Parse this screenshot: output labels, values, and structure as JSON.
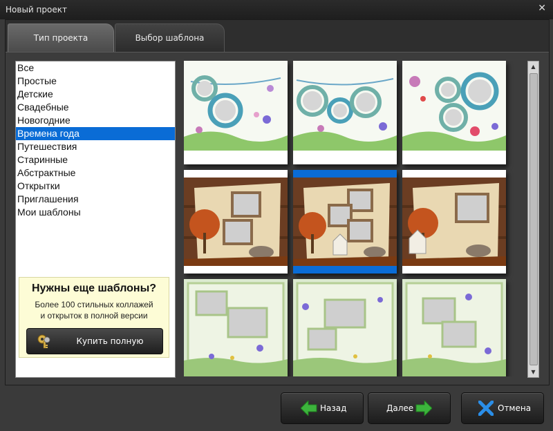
{
  "window": {
    "title": "Новый проект",
    "close_glyph": "✕"
  },
  "tabs": [
    {
      "label": "Тип проекта",
      "active": true
    },
    {
      "label": "Выбор шаблона",
      "active": false
    }
  ],
  "categories": [
    {
      "label": "Все",
      "selected": false
    },
    {
      "label": "Простые",
      "selected": false
    },
    {
      "label": "Детские",
      "selected": false
    },
    {
      "label": "Свадебные",
      "selected": false
    },
    {
      "label": "Новогодние",
      "selected": false
    },
    {
      "label": "Времена года",
      "selected": true
    },
    {
      "label": "Путешествия",
      "selected": false
    },
    {
      "label": "Старинные",
      "selected": false
    },
    {
      "label": "Абстрактные",
      "selected": false
    },
    {
      "label": "Открытки",
      "selected": false
    },
    {
      "label": "Приглашения",
      "selected": false
    },
    {
      "label": "Мои шаблоны",
      "selected": false
    }
  ],
  "promo": {
    "title": "Нужны еще шаблоны?",
    "line1": "Более 100 стильных коллажей",
    "line2": "и открыток в полной версии",
    "buy_label": "Купить полную версию!",
    "buy_icon": "keys-icon"
  },
  "templates": [
    {
      "theme": "spring-garlands",
      "selected": false
    },
    {
      "theme": "spring-garlands",
      "selected": false
    },
    {
      "theme": "spring-garlands",
      "selected": false
    },
    {
      "theme": "autumn-wood",
      "selected": false
    },
    {
      "theme": "autumn-wood",
      "selected": true
    },
    {
      "theme": "autumn-wood",
      "selected": false
    },
    {
      "theme": "spring-flowers-frame",
      "selected": false
    },
    {
      "theme": "spring-flowers-frame",
      "selected": false
    },
    {
      "theme": "spring-flowers-frame",
      "selected": false
    }
  ],
  "scrollbar": {
    "up_glyph": "▲",
    "down_glyph": "▼"
  },
  "buttons": {
    "back": {
      "label": "Назад",
      "icon": "arrow-left-icon"
    },
    "next": {
      "label": "Далее",
      "icon": "arrow-right-icon"
    },
    "cancel": {
      "label": "Отмена",
      "icon": "cross-icon"
    }
  },
  "colors": {
    "accent": "#0a6cd6",
    "arrow_green": "#3cb43c",
    "cancel_blue": "#2a8ee8"
  }
}
